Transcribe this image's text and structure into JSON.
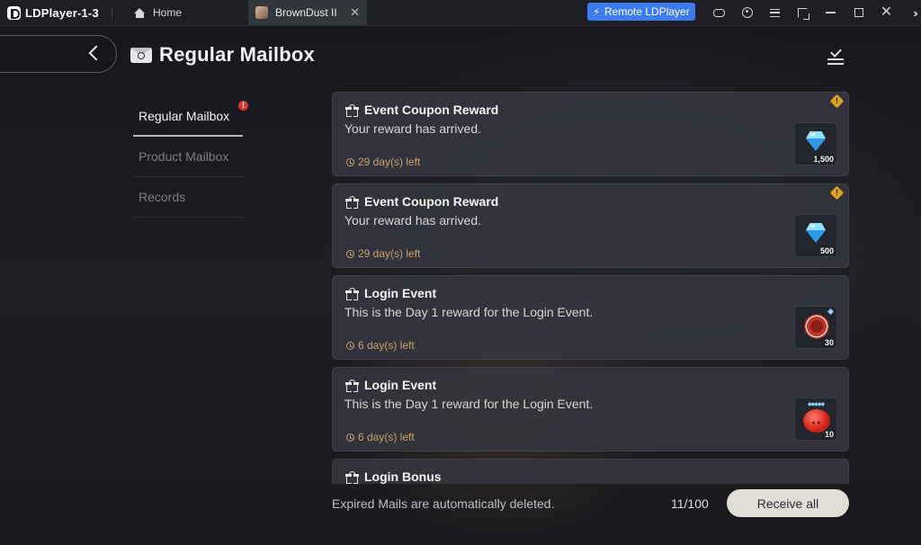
{
  "app": {
    "title": "LDPlayer-1-3",
    "tabs": [
      {
        "label": "Home",
        "icon": "home-icon"
      },
      {
        "label": "BrownDust II",
        "icon": "game-avatar-icon",
        "active": true
      }
    ],
    "remote_button": "Remote LDPlayer",
    "accent_color": "#3d7bf0"
  },
  "header": {
    "title": "Regular Mailbox",
    "icon": "envelope-icon"
  },
  "sidebar": {
    "items": [
      {
        "label": "Regular Mailbox",
        "active": true,
        "alert": "!"
      },
      {
        "label": "Product Mailbox",
        "active": false
      },
      {
        "label": "Records",
        "active": false
      }
    ]
  },
  "mails": [
    {
      "title": "Event Coupon Reward",
      "description": "Your reward has arrived.",
      "time_left": "29 day(s) left",
      "warning": "!",
      "reward": {
        "icon": "diamond-gem-icon",
        "quantity": "1,500"
      }
    },
    {
      "title": "Event Coupon Reward",
      "description": "Your reward has arrived.",
      "time_left": "29 day(s) left",
      "warning": "!",
      "reward": {
        "icon": "diamond-gem-icon",
        "quantity": "500"
      }
    },
    {
      "title": "Login Event",
      "description": "This is the Day 1 reward for the Login Event.",
      "time_left": "6 day(s) left",
      "reward": {
        "icon": "red-chip-icon",
        "quantity": "30"
      }
    },
    {
      "title": "Login Event",
      "description": "This is the Day 1 reward for the Login Event.",
      "time_left": "6 day(s) left",
      "reward": {
        "icon": "red-bomb-icon",
        "quantity": "10"
      }
    },
    {
      "title": "Login Bonus"
    }
  ],
  "footer": {
    "note": "Expired Mails are automatically deleted.",
    "count": "11/100",
    "receive_all": "Receive all"
  }
}
